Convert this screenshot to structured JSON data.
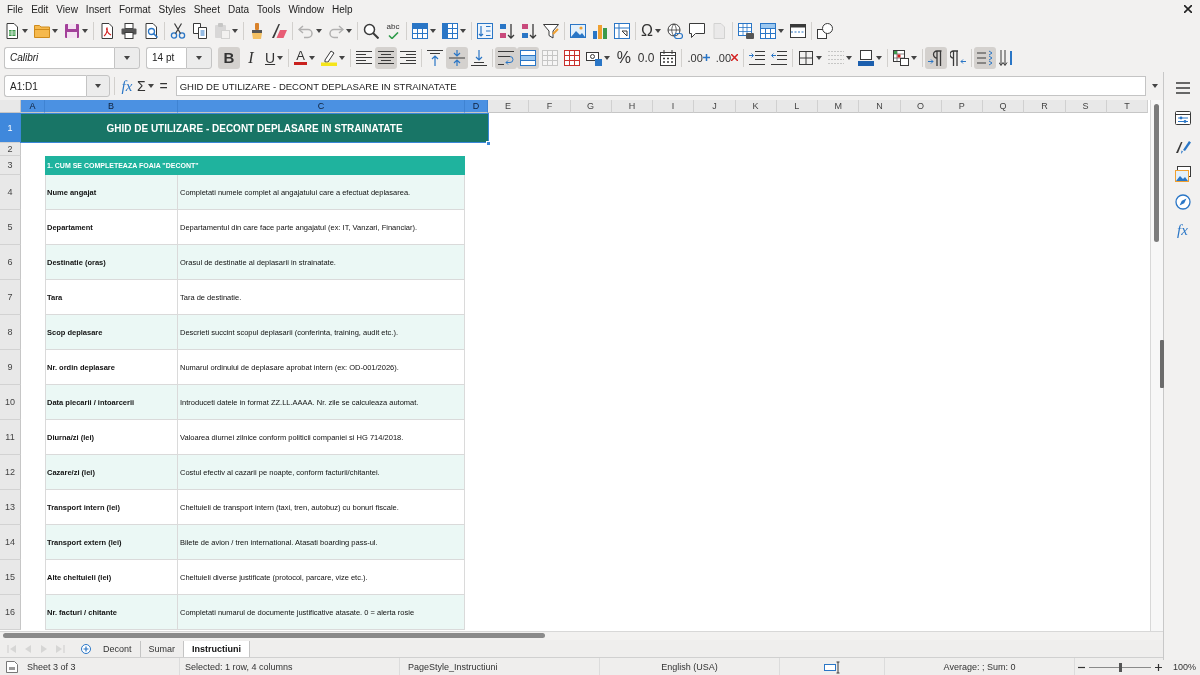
{
  "menu_bar": {
    "items": [
      "File",
      "Edit",
      "View",
      "Insert",
      "Format",
      "Styles",
      "Sheet",
      "Data",
      "Tools",
      "Window",
      "Help"
    ]
  },
  "standard_toolbar": {
    "groups": [
      {
        "buttons": [
          {
            "kind": "new-document",
            "menu": true,
            "disabled": false
          },
          {
            "kind": "open",
            "menu": true,
            "disabled": false
          },
          {
            "kind": "save",
            "menu": true,
            "disabled": false
          }
        ]
      },
      {
        "buttons": [
          {
            "kind": "export-pdf",
            "menu": false,
            "disabled": false
          },
          {
            "kind": "print",
            "menu": false,
            "disabled": false
          },
          {
            "kind": "print-preview",
            "menu": false,
            "disabled": false
          }
        ]
      },
      {
        "buttons": [
          {
            "kind": "cut",
            "menu": false,
            "disabled": false
          },
          {
            "kind": "copy",
            "menu": false,
            "disabled": false
          },
          {
            "kind": "paste",
            "menu": true,
            "disabled": true
          }
        ]
      },
      {
        "buttons": [
          {
            "kind": "clone-formatting",
            "menu": false,
            "disabled": false
          },
          {
            "kind": "clear-formatting",
            "menu": false,
            "disabled": false
          }
        ]
      },
      {
        "buttons": [
          {
            "kind": "undo",
            "menu": true,
            "disabled": true
          },
          {
            "kind": "redo",
            "menu": true,
            "disabled": true
          }
        ]
      },
      {
        "buttons": [
          {
            "kind": "find-replace",
            "menu": false,
            "disabled": false
          },
          {
            "kind": "spelling",
            "glyph": "abc",
            "menu": false,
            "disabled": false
          }
        ]
      },
      {
        "buttons": [
          {
            "kind": "insert-rows",
            "menu": true,
            "disabled": false
          },
          {
            "kind": "insert-columns",
            "menu": true,
            "disabled": false
          }
        ]
      },
      {
        "buttons": [
          {
            "kind": "sort",
            "menu": false,
            "disabled": false
          },
          {
            "kind": "sort-ascending",
            "menu": false,
            "disabled": false
          },
          {
            "kind": "sort-descending",
            "menu": false,
            "disabled": false
          },
          {
            "kind": "autofilter",
            "menu": false,
            "disabled": false
          }
        ]
      },
      {
        "buttons": [
          {
            "kind": "image",
            "menu": false,
            "disabled": false
          },
          {
            "kind": "chart",
            "menu": false,
            "disabled": false
          },
          {
            "kind": "pivot-table",
            "menu": false,
            "disabled": false
          }
        ]
      },
      {
        "buttons": [
          {
            "kind": "special-character",
            "glyph": "Ω",
            "menu": true,
            "disabled": false
          },
          {
            "kind": "hyperlink",
            "menu": false,
            "disabled": false
          },
          {
            "kind": "comment",
            "menu": false,
            "disabled": false
          },
          {
            "kind": "header-footer",
            "menu": false,
            "disabled": true
          }
        ]
      },
      {
        "buttons": [
          {
            "kind": "print-area",
            "menu": false,
            "disabled": false
          },
          {
            "kind": "freeze",
            "menu": true,
            "disabled": false
          },
          {
            "kind": "split-window",
            "menu": false,
            "disabled": false
          }
        ]
      },
      {
        "buttons": [
          {
            "kind": "shapes",
            "menu": false,
            "disabled": false
          }
        ]
      }
    ]
  },
  "formatting_toolbar": {
    "font_name": "Calibri",
    "font_size": "14 pt",
    "groups": [
      {
        "buttons": [
          {
            "kind": "bold",
            "glyph": "B",
            "menu": false,
            "pressed": true,
            "disabled": false
          },
          {
            "kind": "italic",
            "glyph": "I",
            "menu": false,
            "pressed": false,
            "disabled": false
          },
          {
            "kind": "underline",
            "glyph": "U",
            "menu": true,
            "pressed": false,
            "disabled": false
          }
        ]
      },
      {
        "buttons": [
          {
            "kind": "font-color",
            "glyph": "A",
            "menu": true,
            "pressed": false,
            "disabled": false
          },
          {
            "kind": "highlight",
            "menu": true,
            "pressed": false,
            "disabled": false
          }
        ]
      },
      {
        "buttons": [
          {
            "kind": "align-left",
            "menu": false,
            "pressed": false,
            "disabled": false
          },
          {
            "kind": "align-center",
            "menu": false,
            "pressed": true,
            "disabled": false
          },
          {
            "kind": "align-right",
            "menu": false,
            "pressed": false,
            "disabled": false
          }
        ]
      },
      {
        "buttons": [
          {
            "kind": "align-top",
            "menu": false,
            "pressed": false,
            "disabled": false
          },
          {
            "kind": "align-middle",
            "menu": false,
            "pressed": true,
            "disabled": false
          },
          {
            "kind": "align-bottom",
            "menu": false,
            "pressed": false,
            "disabled": false
          }
        ]
      },
      {
        "buttons": [
          {
            "kind": "wrap-text",
            "menu": false,
            "pressed": true,
            "disabled": false
          },
          {
            "kind": "merge-center",
            "menu": false,
            "pressed": true,
            "disabled": false
          },
          {
            "kind": "merge-cells",
            "menu": false,
            "pressed": false,
            "disabled": true
          },
          {
            "kind": "unmerge-cells",
            "menu": false,
            "pressed": false,
            "disabled": false
          },
          {
            "kind": "currency",
            "menu": true,
            "pressed": false,
            "disabled": false
          },
          {
            "kind": "percent",
            "glyph": "%",
            "menu": false,
            "pressed": false,
            "disabled": false
          },
          {
            "kind": "number",
            "glyph": "0.0",
            "menu": false,
            "pressed": false,
            "disabled": false
          },
          {
            "kind": "date",
            "menu": false,
            "pressed": false,
            "disabled": false
          }
        ]
      },
      {
        "buttons": [
          {
            "kind": "add-decimal",
            "glyph": ".00",
            "menu": false,
            "pressed": false,
            "disabled": false
          },
          {
            "kind": "delete-decimal",
            "glyph": ".00",
            "menu": false,
            "pressed": false,
            "disabled": false
          }
        ]
      },
      {
        "buttons": [
          {
            "kind": "increase-indent",
            "menu": false,
            "pressed": false,
            "disabled": false
          },
          {
            "kind": "decrease-indent",
            "menu": false,
            "pressed": false,
            "disabled": false
          }
        ]
      },
      {
        "buttons": [
          {
            "kind": "borders",
            "menu": true,
            "pressed": false,
            "disabled": false
          },
          {
            "kind": "border-style",
            "menu": true,
            "pressed": false,
            "disabled": true
          },
          {
            "kind": "border-color",
            "menu": true,
            "pressed": false,
            "disabled": false
          }
        ]
      },
      {
        "buttons": [
          {
            "kind": "conditional",
            "menu": true,
            "pressed": false,
            "disabled": false
          }
        ]
      },
      {
        "buttons": [
          {
            "kind": "left-to-right",
            "menu": false,
            "pressed": true,
            "disabled": false
          },
          {
            "kind": "right-to-left",
            "menu": false,
            "pressed": false,
            "disabled": false
          }
        ]
      },
      {
        "buttons": [
          {
            "kind": "text-left-right",
            "menu": false,
            "pressed": true,
            "disabled": false
          },
          {
            "kind": "text-top-bottom",
            "menu": false,
            "pressed": false,
            "disabled": false
          }
        ]
      }
    ]
  },
  "formula_bar": {
    "name_box": "A1:D1",
    "buttons": [
      {
        "kind": "function-wizard",
        "glyph": "fx",
        "menu": false
      },
      {
        "kind": "sum",
        "glyph": "Σ",
        "menu": true
      },
      {
        "kind": "formula",
        "glyph": "=",
        "menu": false
      }
    ],
    "content": "GHID DE UTILIZARE - DECONT DEPLASARE IN STRAINATATE"
  },
  "sidebar": {
    "buttons": [
      {
        "kind": "menu"
      },
      {
        "kind": "properties"
      },
      {
        "kind": "styles"
      },
      {
        "kind": "gallery"
      },
      {
        "kind": "navigator"
      },
      {
        "kind": "functions",
        "glyph": "fx"
      }
    ]
  },
  "sheet": {
    "columns": [
      {
        "label": "A",
        "selected": true
      },
      {
        "label": "B",
        "selected": true
      },
      {
        "label": "C",
        "selected": true
      },
      {
        "label": "D",
        "selected": true
      },
      {
        "label": "E",
        "selected": false
      },
      {
        "label": "F",
        "selected": false
      },
      {
        "label": "G",
        "selected": false
      },
      {
        "label": "H",
        "selected": false
      },
      {
        "label": "I",
        "selected": false
      },
      {
        "label": "J",
        "selected": false
      },
      {
        "label": "K",
        "selected": false
      },
      {
        "label": "L",
        "selected": false
      },
      {
        "label": "M",
        "selected": false
      },
      {
        "label": "N",
        "selected": false
      },
      {
        "label": "O",
        "selected": false
      },
      {
        "label": "P",
        "selected": false
      },
      {
        "label": "Q",
        "selected": false
      },
      {
        "label": "R",
        "selected": false
      },
      {
        "label": "S",
        "selected": false
      },
      {
        "label": "T",
        "selected": false
      }
    ],
    "rows": [
      {
        "kind": "title",
        "number": "1",
        "selected": true,
        "text": "GHID DE UTILIZARE - DECONT DEPLASARE IN STRAINATATE"
      },
      {
        "kind": "blank",
        "number": "2",
        "selected": false
      },
      {
        "kind": "section",
        "number": "3",
        "selected": false,
        "text": "1. CUM SE COMPLETEAZA FOAIA \"DECONT\""
      },
      {
        "kind": "entry",
        "number": "4",
        "selected": false,
        "shaded": true,
        "field": "Nume angajat",
        "description": "Completati numele complet al angajatului care a efectuat deplasarea."
      },
      {
        "kind": "entry",
        "number": "5",
        "selected": false,
        "shaded": false,
        "field": "Departament",
        "description": "Departamentul din care face parte angajatul (ex: IT, Vanzari, Financiar)."
      },
      {
        "kind": "entry",
        "number": "6",
        "selected": false,
        "shaded": true,
        "field": "Destinatie (oras)",
        "description": "Orasul de destinatie al deplasarii in strainatate."
      },
      {
        "kind": "entry",
        "number": "7",
        "selected": false,
        "shaded": false,
        "field": "Tara",
        "description": "Tara de destinatie."
      },
      {
        "kind": "entry",
        "number": "8",
        "selected": false,
        "shaded": true,
        "field": "Scop deplasare",
        "description": "Descrieti succint scopul deplasarii (conferinta, training, audit etc.)."
      },
      {
        "kind": "entry",
        "number": "9",
        "selected": false,
        "shaded": false,
        "field": "Nr. ordin deplasare",
        "description": "Numarul ordinului de deplasare aprobat intern (ex: OD-001/2026)."
      },
      {
        "kind": "entry",
        "number": "10",
        "selected": false,
        "shaded": true,
        "field": "Data plecarii / intoarcerii",
        "description": "Introduceti datele in format ZZ.LL.AAAA. Nr. zile se calculeaza automat."
      },
      {
        "kind": "entry",
        "number": "11",
        "selected": false,
        "shaded": false,
        "field": "Diurna/zi (lei)",
        "description": "Valoarea diurnei zilnice conform politicii companiei si HG 714/2018."
      },
      {
        "kind": "entry",
        "number": "12",
        "selected": false,
        "shaded": true,
        "field": "Cazare/zi (lei)",
        "description": "Costul efectiv al cazarii pe noapte, conform facturii/chitantei."
      },
      {
        "kind": "entry",
        "number": "13",
        "selected": false,
        "shaded": false,
        "field": "Transport intern (lei)",
        "description": "Cheltuieli de transport intern (taxi, tren, autobuz) cu bonuri fiscale."
      },
      {
        "kind": "entry",
        "number": "14",
        "selected": false,
        "shaded": true,
        "field": "Transport extern (lei)",
        "description": "Bilete de avion / tren international. Atasati boarding pass-ul."
      },
      {
        "kind": "entry",
        "number": "15",
        "selected": false,
        "shaded": false,
        "field": "Alte cheltuieli (lei)",
        "description": "Cheltuieli diverse justificate (protocol, parcare, vize etc.)."
      },
      {
        "kind": "entry",
        "number": "16",
        "selected": false,
        "shaded": true,
        "field": "Nr. facturi / chitante",
        "description": "Completati numarul de documente justificative atasate. 0 = alerta rosie"
      }
    ]
  },
  "sheet_tabs": {
    "navigation": [
      {
        "kind": "first",
        "disabled": true
      },
      {
        "kind": "previous",
        "disabled": true
      },
      {
        "kind": "next",
        "disabled": true
      },
      {
        "kind": "last",
        "disabled": true
      }
    ],
    "tabs": [
      {
        "label": "Decont",
        "selected": false
      },
      {
        "label": "Sumar",
        "selected": false
      },
      {
        "label": "Instructiuni",
        "selected": true
      }
    ]
  },
  "status_bar": {
    "sheet": "Sheet 3 of 3",
    "selection": "Selected: 1 row, 4 columns",
    "page_style": "PageStyle_Instructiuni",
    "language": "English (USA)",
    "summary": "Average: ; Sum: 0",
    "zoom": {
      "level": 0.5,
      "reading": "100%"
    }
  }
}
